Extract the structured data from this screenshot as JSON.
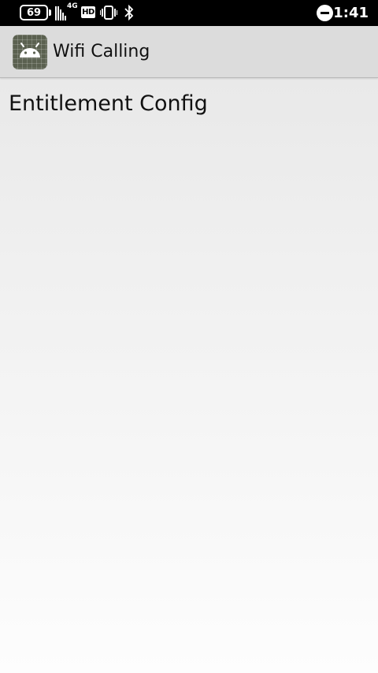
{
  "status_bar": {
    "battery_level": "69",
    "network_type": "4G",
    "hd_label": "HD",
    "time": "1:41",
    "icons": [
      "battery-icon",
      "signal-icon",
      "hd-icon",
      "vibrate-icon",
      "bluetooth-icon",
      "do-not-disturb-icon"
    ]
  },
  "app_bar": {
    "icon": "android-icon",
    "title": "Wifi Calling"
  },
  "main": {
    "heading": "Entitlement Config"
  }
}
